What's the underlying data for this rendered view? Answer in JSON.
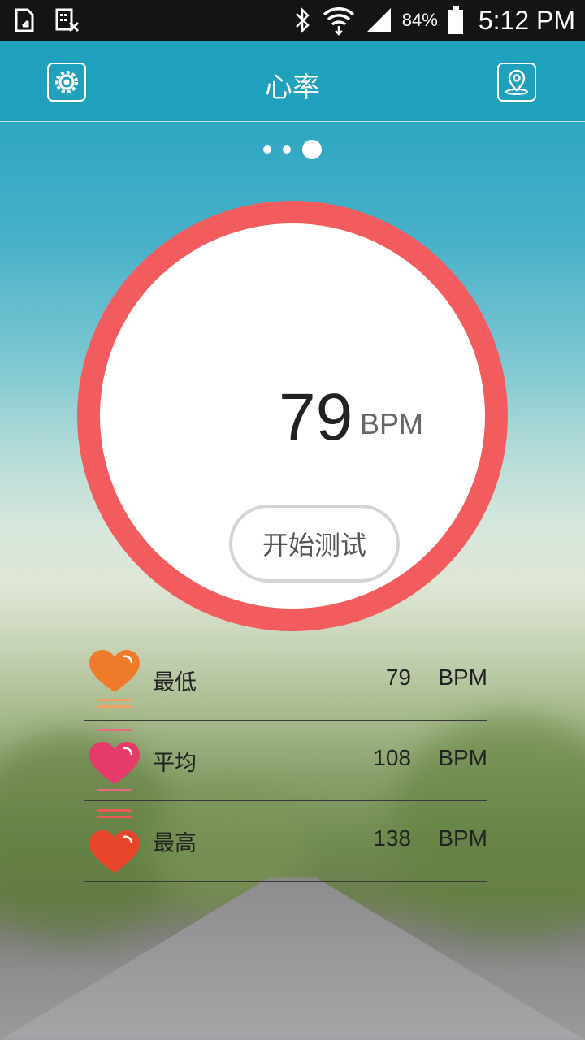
{
  "status_bar": {
    "battery": "84%",
    "time": "5:12 PM",
    "icons": [
      "sim-transfer-icon",
      "storage-off-icon",
      "bluetooth-icon",
      "wifi-icon",
      "signal-icon",
      "battery-icon"
    ]
  },
  "header": {
    "title": "心率",
    "left_icon": "settings-gear-icon",
    "right_icon": "location-pin-icon",
    "color": "#1fa0bd"
  },
  "pager": {
    "count": 3,
    "active_index": 2
  },
  "gauge": {
    "value": "79",
    "unit": "BPM",
    "start_button": "开始测试",
    "ring_color": "#f25c5e"
  },
  "stats": [
    {
      "label": "最低",
      "value": "79",
      "unit": "BPM",
      "icon": "heart-low-icon",
      "color": "#ee7a2a"
    },
    {
      "label": "平均",
      "value": "108",
      "unit": "BPM",
      "icon": "heart-average-icon",
      "color": "#e43b6a"
    },
    {
      "label": "最高",
      "value": "138",
      "unit": "BPM",
      "icon": "heart-high-icon",
      "color": "#e9452a"
    }
  ]
}
